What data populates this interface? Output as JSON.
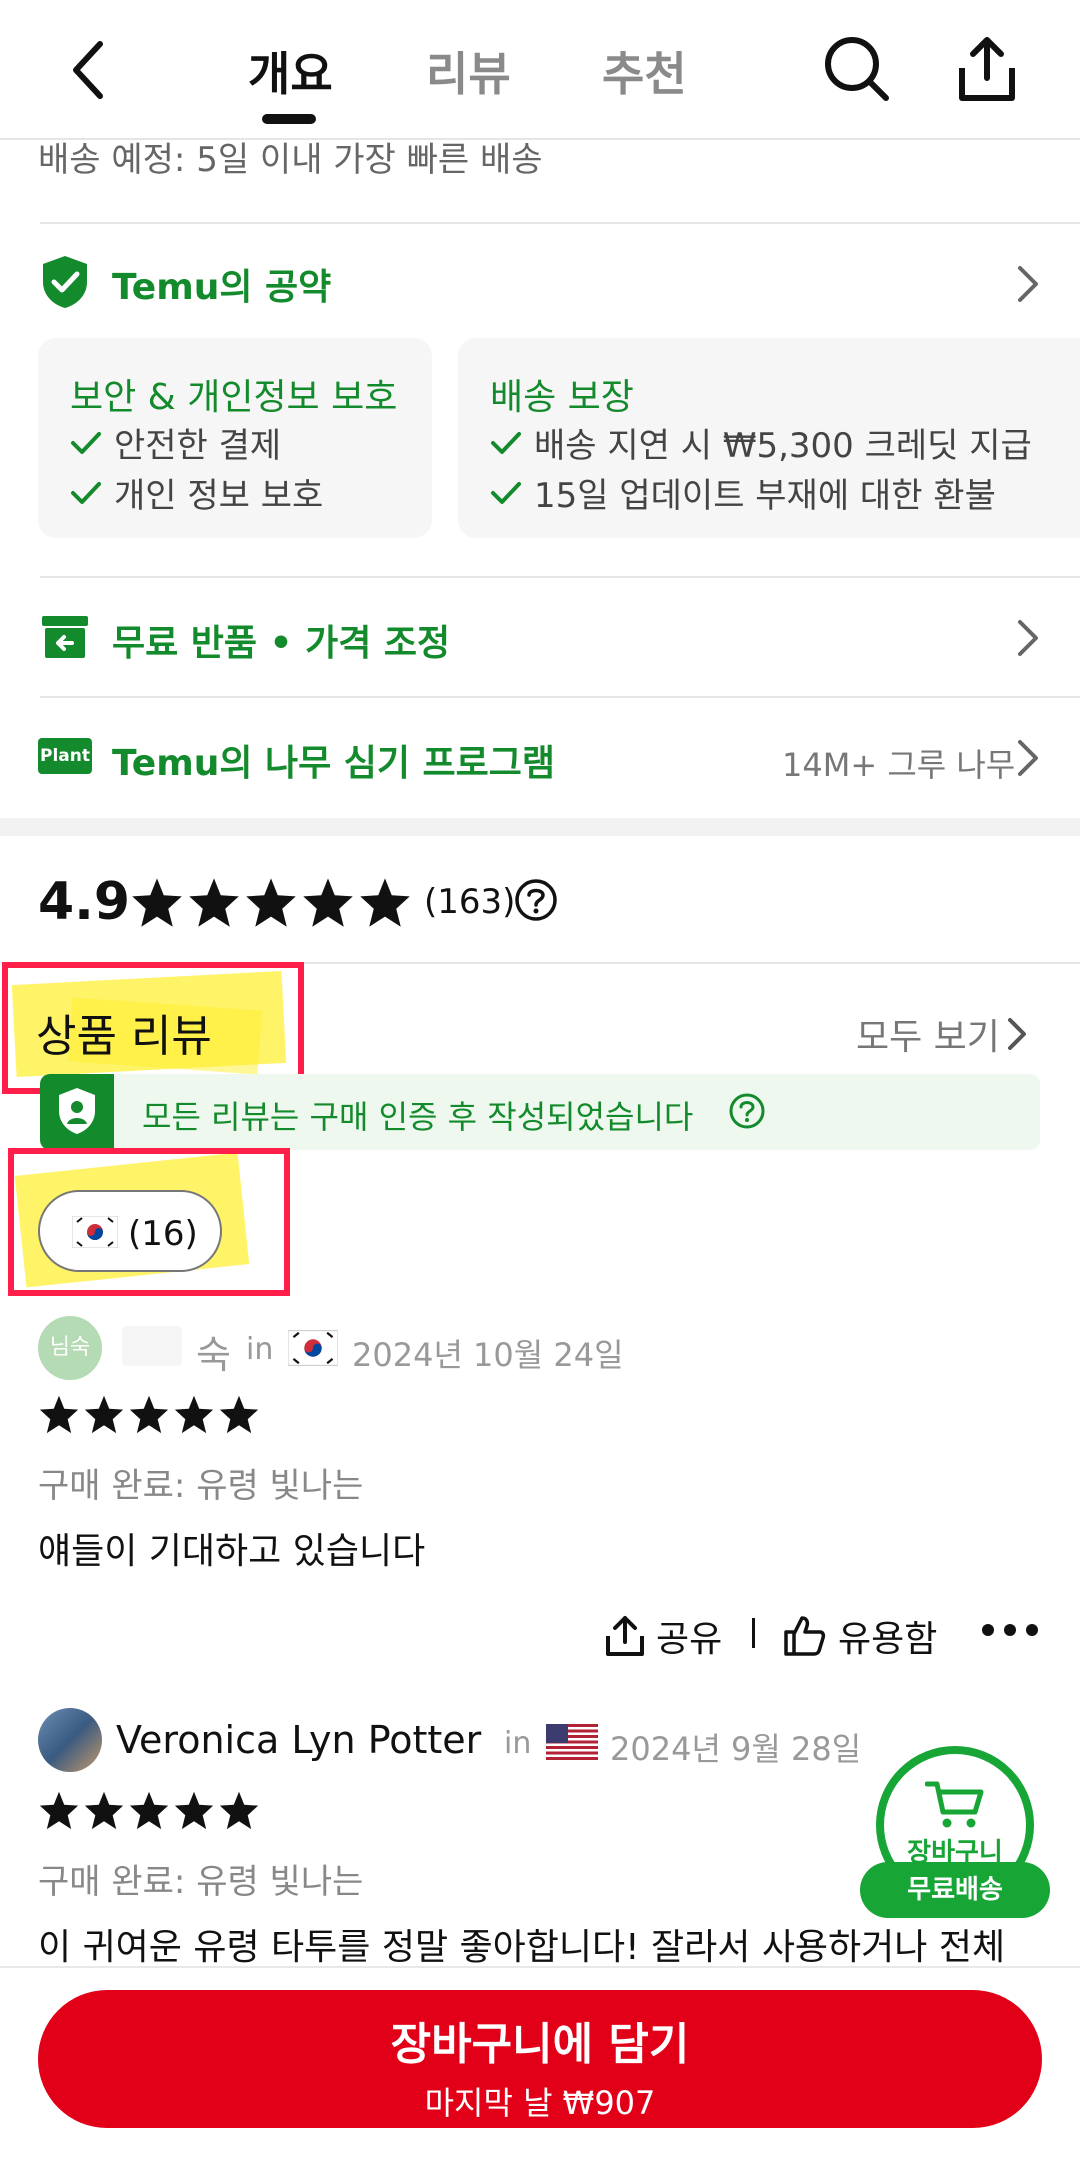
{
  "header": {
    "tabs": [
      {
        "label": "개요",
        "active": true
      },
      {
        "label": "리뷰",
        "active": false
      },
      {
        "label": "추천",
        "active": false
      }
    ]
  },
  "shipping": {
    "text": "배송 예정: 5일 이내 가장 빠른 배송"
  },
  "promise": {
    "title": "Temu의 공약",
    "cards": [
      {
        "title": "보안 & 개인정보 보호",
        "items": [
          "안전한 결제",
          "개인 정보 보호"
        ]
      },
      {
        "title": "배송 보장",
        "items": [
          "배송 지연 시 ₩5,300 크레딧 지급",
          "15일 업데이트 부재에 대한 환불"
        ]
      }
    ]
  },
  "free_return": {
    "title": "무료 반품 • 가격 조정"
  },
  "tree_program": {
    "badge": "Plant",
    "title": "Temu의 나무 심기 프로그램",
    "count": "14M+ 그루 나무"
  },
  "rating": {
    "score": "4.9",
    "stars": 5,
    "count": "(163)"
  },
  "reviews": {
    "section_title": "상품 리뷰",
    "see_all": "모두 보기",
    "verified_text": "모든 리뷰는 구매 인증 후 작성되었습니다",
    "filter_chip": "(16)",
    "items": [
      {
        "avatar_text": "님숙",
        "author": "숙",
        "in": "in",
        "date": "2024년 10월 24일",
        "stars": 5,
        "purchase": "구매 완료: 유령 빛나는",
        "text": "얘들이 기대하고 있습니다",
        "share_label": "공유",
        "helpful_label": "유용함"
      },
      {
        "author": "Veronica Lyn Potter",
        "in": "in",
        "date": "2024년 9월 28일",
        "stars": 5,
        "purchase": "구매 완료: 유령 빛나는",
        "text": "이 귀여운 유령 타투를 정말 좋아합니다! 잘라서 사용하거나 전체"
      }
    ]
  },
  "cart_float": {
    "label": "장바구니",
    "pill": "무료배송"
  },
  "bottom": {
    "button_label": "장바구니에 담기",
    "button_sub": "마지막 날 ₩907"
  },
  "colors": {
    "accent_green": "#138a2c",
    "primary_red": "#e10018",
    "highlight_red": "#ff1f4a",
    "highlight_yellow": "#ffee28"
  }
}
